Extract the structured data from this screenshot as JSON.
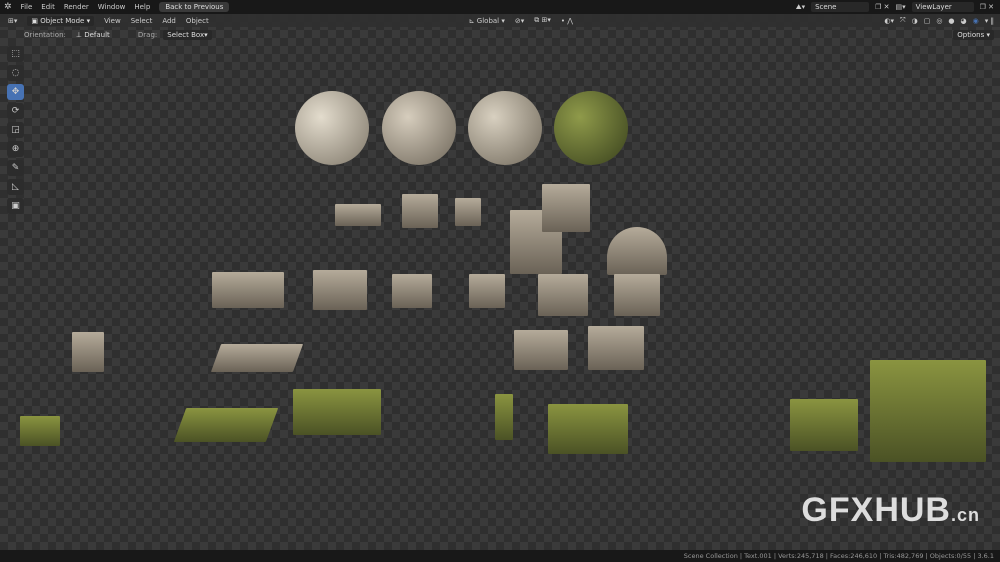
{
  "menu": {
    "items": [
      "File",
      "Edit",
      "Render",
      "Window",
      "Help"
    ],
    "back": "Back to Previous",
    "scene": "Scene",
    "view_layer": "ViewLayer"
  },
  "header": {
    "mode": "Object Mode",
    "menus": [
      "View",
      "Select",
      "Add",
      "Object"
    ],
    "transform": "Global"
  },
  "tool_settings": {
    "orientation_label": "Orientation:",
    "orientation": "Default",
    "drag_label": "Drag:",
    "drag": "Select Box",
    "options": "Options"
  },
  "tools": [
    "select-box",
    "cursor",
    "move",
    "rotate",
    "scale",
    "transform",
    "annotate",
    "measure",
    "add-cube"
  ],
  "status": "Scene Collection | Text.001 | Verts:245,718 | Faces:246,610 | Tris:482,769 | Objects:0/55 | 3.6.1",
  "watermark": {
    "main": "GFXHUB",
    "suffix": ".cn"
  },
  "colors": {
    "accent": "#4772b3"
  }
}
